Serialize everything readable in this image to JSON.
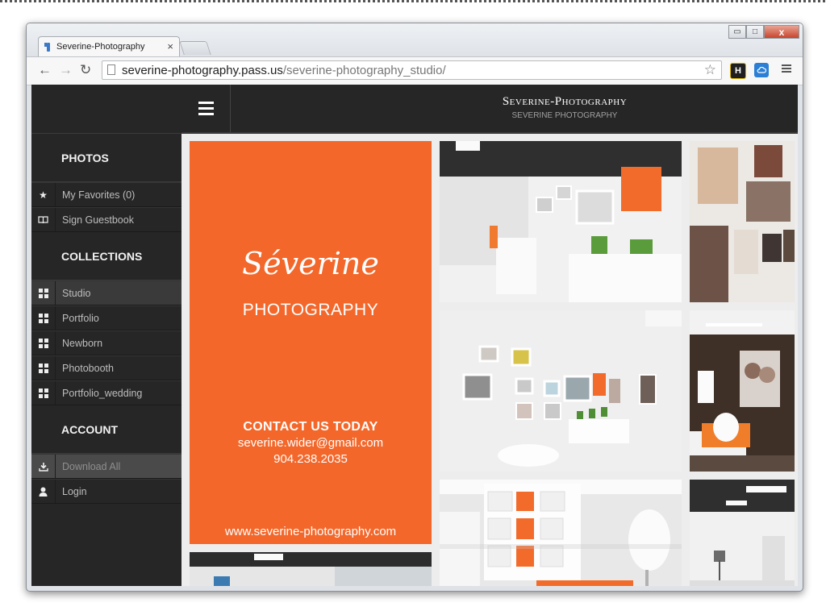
{
  "browser": {
    "tab_title": "Severine-Photography",
    "tab_close": "×",
    "url_host": "severine-photography.pass.us",
    "url_path": "/severine-photography_studio/",
    "window_buttons": {
      "minimize": "▭",
      "maximize": "□",
      "close": "x"
    },
    "extensions": [
      {
        "name": "h-extension-icon",
        "text": "H",
        "color": "#1f1f1f"
      },
      {
        "name": "cloud-extension-icon",
        "text": "",
        "color": "#2b7fd4"
      }
    ]
  },
  "header": {
    "title": "Severine-Photography",
    "subtitle": "SEVERINE PHOTOGRAPHY"
  },
  "sidebar": {
    "sections": [
      {
        "heading": "PHOTOS",
        "items": [
          {
            "label": "My Favorites (0)",
            "icon": "star-icon",
            "glyph": "★"
          },
          {
            "label": "Sign Guestbook",
            "icon": "book-icon",
            "glyph": "📖"
          }
        ]
      },
      {
        "heading": "COLLECTIONS",
        "items": [
          {
            "label": "Studio",
            "icon": "grid-icon",
            "active": true
          },
          {
            "label": "Portfolio",
            "icon": "grid-icon"
          },
          {
            "label": "Newborn",
            "icon": "grid-icon"
          },
          {
            "label": "Photobooth",
            "icon": "grid-icon"
          },
          {
            "label": "Portfolio_wedding",
            "icon": "grid-icon"
          }
        ]
      },
      {
        "heading": "ACCOUNT",
        "items": [
          {
            "label": "Download All",
            "icon": "download-icon",
            "glyph": "⬇"
          },
          {
            "label": "Login",
            "icon": "user-icon",
            "glyph": "👤"
          }
        ]
      }
    ]
  },
  "feature_card": {
    "logo_script": "Séverine",
    "logo_sub": "PHOTOGRAPHY",
    "contact_heading": "CONTACT US TODAY",
    "email": "severine.wider@gmail.com",
    "phone": "904.238.2035",
    "website": "www.severine-photography.com",
    "color": "#f3672a"
  }
}
